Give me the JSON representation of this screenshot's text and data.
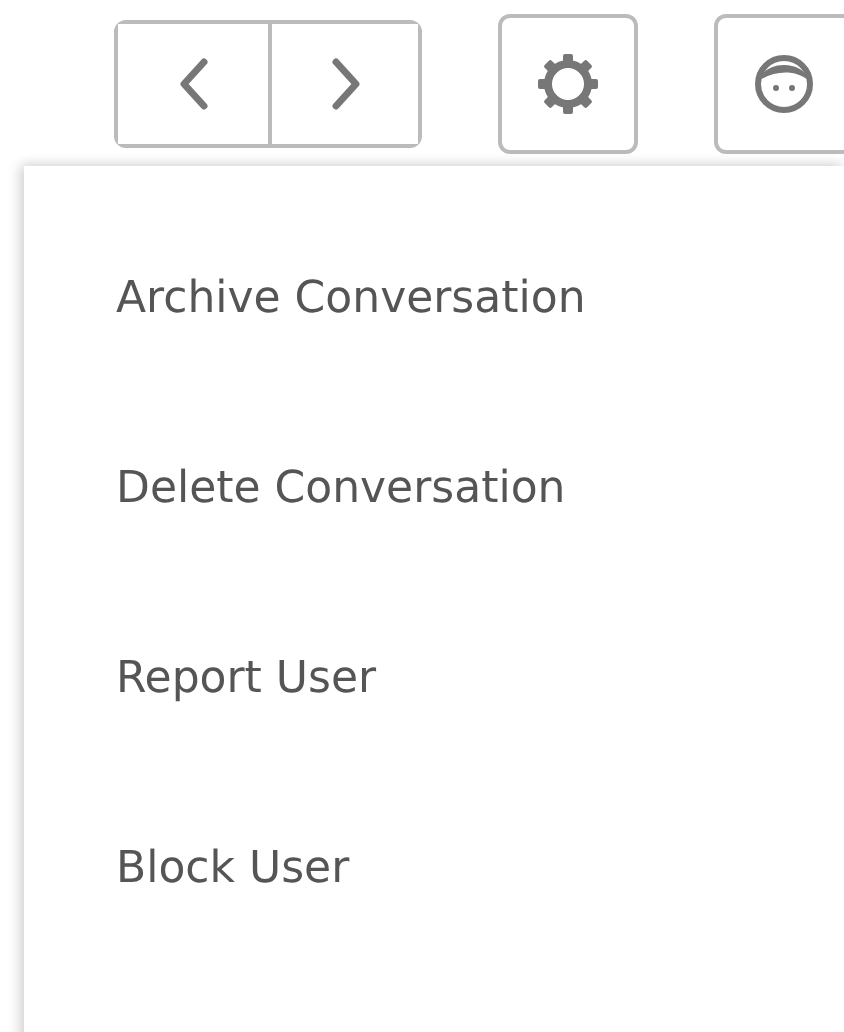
{
  "menu": {
    "items": [
      {
        "label": "Archive Conversation"
      },
      {
        "label": "Delete Conversation"
      },
      {
        "label": "Report User"
      },
      {
        "label": "Block User"
      }
    ]
  }
}
